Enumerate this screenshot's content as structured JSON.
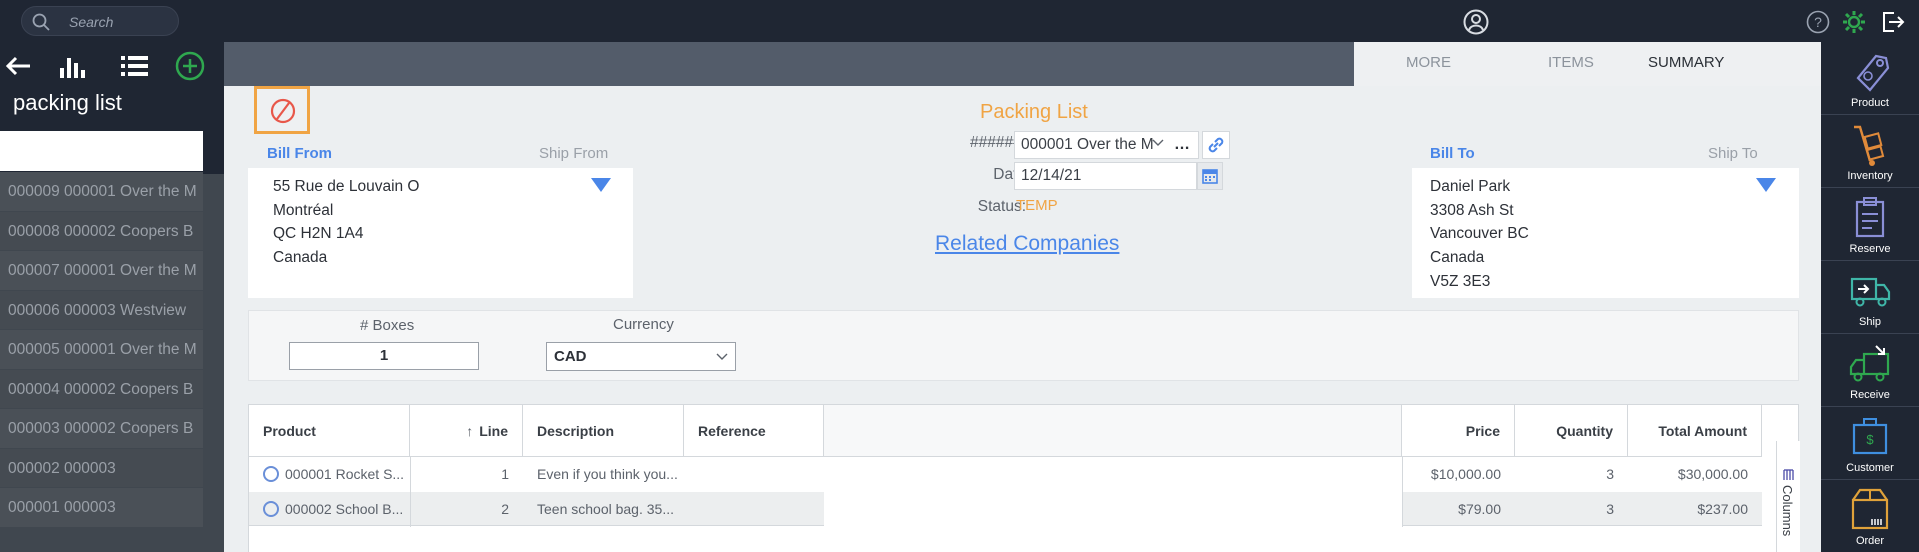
{
  "topbar": {
    "search_placeholder": "Search"
  },
  "sidebar": {
    "title": "packing list",
    "items": [
      "000009 000001 Over the M",
      "000008 000002 Coopers B",
      "000007 000001 Over the M",
      "000006 000003 Westview",
      "000005 000001 Over the M",
      "000004 000002 Coopers B",
      "000003 000002 Coopers B",
      "000002 000003",
      "000001 000003"
    ]
  },
  "tabs": {
    "more": "MORE",
    "items": "ITEMS",
    "summary": "SUMMARY",
    "active": "SUMMARY"
  },
  "document": {
    "title": "Packing List",
    "number_label": "######:",
    "number_value": "000001 Over the M",
    "date_label": "Date",
    "date_value": "12/14/21",
    "status_label": "Status:",
    "status_value": "TEMP",
    "related_link": "Related Companies"
  },
  "bill_from": {
    "label": "Bill From",
    "alt_label": "Ship From",
    "lines": [
      "55 Rue de Louvain O",
      "Montréal",
      "QC H2N 1A4",
      "Canada"
    ]
  },
  "bill_to": {
    "label": "Bill To",
    "alt_label": "Ship To",
    "lines": [
      "Daniel Park",
      "3308 Ash St",
      "Vancouver BC",
      "Canada",
      "V5Z 3E3"
    ]
  },
  "options": {
    "boxes_label": "# Boxes",
    "boxes_value": "1",
    "currency_label": "Currency",
    "currency_value": "CAD"
  },
  "grid": {
    "headers": {
      "product": "Product",
      "line": "Line",
      "description": "Description",
      "reference": "Reference",
      "price": "Price",
      "quantity": "Quantity",
      "total": "Total Amount"
    },
    "columns_tab": "Columns",
    "rows": [
      {
        "product": "000001 Rocket S...",
        "line": "1",
        "description": "Even if you think you...",
        "reference": "",
        "price": "$10,000.00",
        "quantity": "3",
        "total": "$30,000.00"
      },
      {
        "product": "000002 School B...",
        "line": "2",
        "description": "Teen school bag. 35...",
        "reference": "",
        "price": "$79.00",
        "quantity": "3",
        "total": "$237.00"
      }
    ]
  },
  "rightbar": {
    "items": [
      "Product",
      "Inventory",
      "Reserve",
      "Ship",
      "Receive",
      "Customer",
      "Order"
    ]
  },
  "colors": {
    "accent_orange": "#f0a444",
    "accent_blue": "#4a86e8",
    "accent_green": "#2fa84f",
    "dark_bar": "#1f2633"
  }
}
